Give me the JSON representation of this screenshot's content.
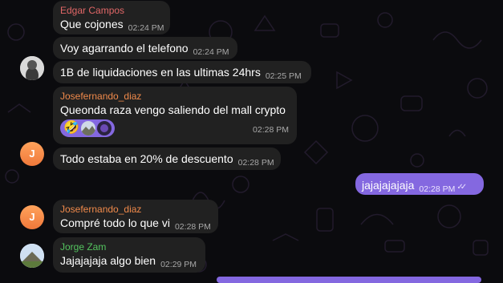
{
  "messages": [
    {
      "sender": "Edgar Campos",
      "text": "Que cojones",
      "time": "02:24 PM"
    },
    {
      "text": "Voy agarrando el telefono",
      "time": "02:24 PM"
    },
    {
      "text": "1B de liquidaciones en las ultimas 24hrs",
      "time": "02:25 PM"
    },
    {
      "sender": "Josefernando_diaz",
      "text": "Queonda raza vengo saliendo del mall crypto",
      "time": "02:28 PM",
      "reaction_emoji": "🤣"
    },
    {
      "text": "Todo estaba en 20% de descuento",
      "time": "02:28 PM",
      "avatar_letter": "J"
    },
    {
      "sender": "Josefernando_diaz",
      "text": "Compré todo lo que vi",
      "time": "02:28 PM",
      "avatar_letter": "J"
    },
    {
      "sender": "Jorge Zam",
      "text": "Jajajajaja algo bien",
      "time": "02:29 PM"
    }
  ],
  "outgoing": {
    "text": "jajajajajaja",
    "time": "02:28 PM",
    "ticks": "✓✓"
  },
  "colors": {
    "background": "#0b0b0e",
    "bubble": "#212121",
    "outgoing_bubble": "#8468e0",
    "sender_edgar": "#e16767",
    "sender_josefernando": "#f08a4b",
    "sender_jorge": "#54c45f"
  }
}
